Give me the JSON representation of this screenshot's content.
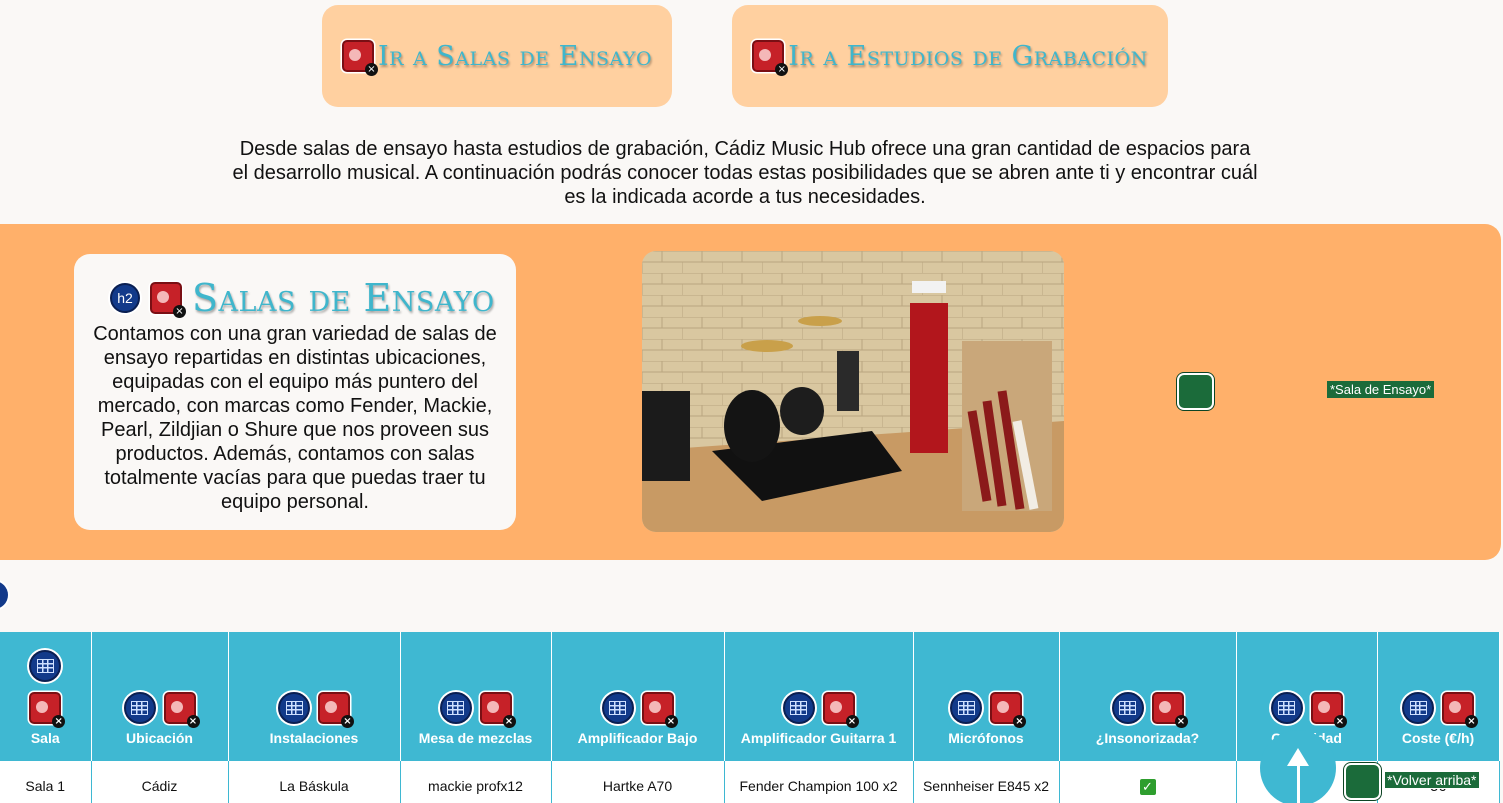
{
  "nav": {
    "salas_label": "Ir a Salas de Ensayo",
    "estudios_label": "Ir a Estudios de Grabación"
  },
  "intro_text": "Desde salas de ensayo hasta estudios de grabación, Cádiz Music Hub ofrece una gran cantidad de espacios para el desarrollo musical. A continuación podrás conocer todas estas posibilidades que se abren ante ti y encontrar cuál es la indicada acorde a tus necesidades.",
  "section": {
    "heading_tag": "h2",
    "title": "Salas de Ensayo",
    "text": "Contamos con una gran variedad de salas de ensayo repartidas en distintas ubicaciones, equipadas con el equipo más puntero del mercado, con marcas como Fender, Mackie, Pearl, Zildjian o Shure que nos proveen sus productos. Además, contamos con salas totalmente vacías para que puedas traer tu equipo personal.",
    "image_alt": "*Sala de Ensayo*"
  },
  "table": {
    "headers": [
      "Sala",
      "Ubicación",
      "Instalaciones",
      "Mesa de mezclas",
      "Amplificador Bajo",
      "Amplificador Guitarra 1",
      "Micrófonos",
      "¿Insonorizada?",
      "Capacidad",
      "Coste (€/h)"
    ],
    "row1": [
      "Sala 1",
      "Cádiz",
      "La Báskula",
      "mackie profx12",
      "Hartke A70",
      "Fender Champion 100 x2",
      "Sennheiser E845 x2",
      "✓",
      "",
      "3€"
    ]
  },
  "back_to_top": "*Volver arriba*"
}
